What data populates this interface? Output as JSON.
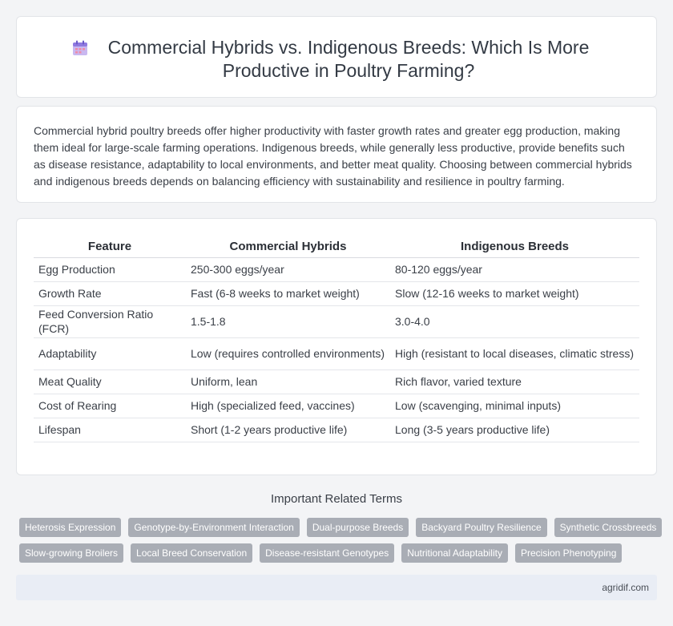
{
  "header": {
    "title": "Commercial Hybrids vs. Indigenous Breeds: Which Is More Productive in Poultry Farming?",
    "icon": "calendar-icon"
  },
  "intro": {
    "text": "Commercial hybrid poultry breeds offer higher productivity with faster growth rates and greater egg production, making them ideal for large-scale farming operations. Indigenous breeds, while generally less productive, provide benefits such as disease resistance, adaptability to local environments, and better meat quality. Choosing between commercial hybrids and indigenous breeds depends on balancing efficiency with sustainability and resilience in poultry farming."
  },
  "table": {
    "headers": [
      "Feature",
      "Commercial Hybrids",
      "Indigenous Breeds"
    ],
    "rows": [
      [
        "Egg Production",
        "250-300 eggs/year",
        "80-120 eggs/year"
      ],
      [
        "Growth Rate",
        "Fast (6-8 weeks to market weight)",
        "Slow (12-16 weeks to market weight)"
      ],
      [
        "Feed Conversion Ratio (FCR)",
        "1.5-1.8",
        "3.0-4.0"
      ],
      [
        "Adaptability",
        "Low (requires controlled environments)",
        "High (resistant to local diseases, climatic stress)"
      ],
      [
        "Meat Quality",
        "Uniform, lean",
        "Rich flavor, varied texture"
      ],
      [
        "Cost of Rearing",
        "High (specialized feed, vaccines)",
        "Low (scavenging, minimal inputs)"
      ],
      [
        "Lifespan",
        "Short (1-2 years productive life)",
        "Long (3-5 years productive life)"
      ]
    ]
  },
  "related": {
    "title": "Important Related Terms",
    "tags_row1": [
      "Heterosis Expression",
      "Genotype-by-Environment Interaction",
      "Dual-purpose Breeds",
      "Backyard Poultry Resilience",
      "Synthetic Crossbreeds"
    ],
    "tags_row2": [
      "Slow-growing Broilers",
      "Local Breed Conservation",
      "Disease-resistant Genotypes",
      "Nutritional Adaptability",
      "Precision Phenotyping"
    ]
  },
  "footer": {
    "site": "agridif.com"
  }
}
